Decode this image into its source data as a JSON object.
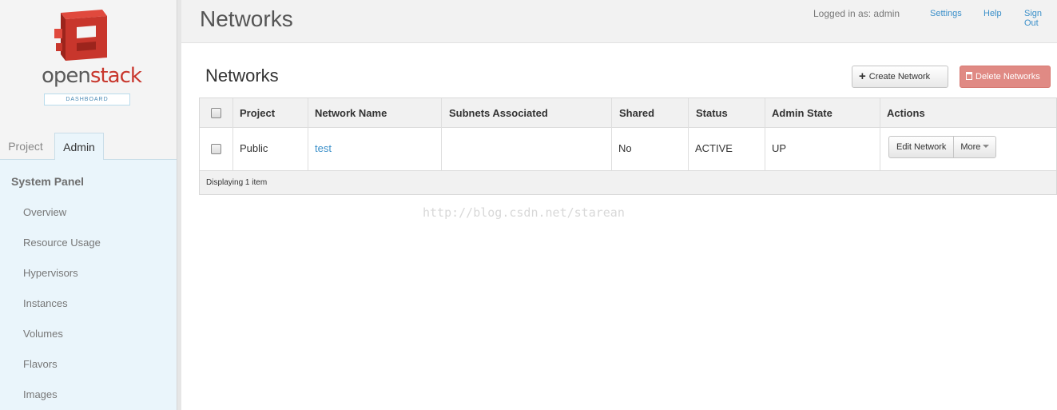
{
  "logo": {
    "brand_open": "open",
    "brand_stack": "stack",
    "subtitle": "DASHBOARD"
  },
  "sidebar": {
    "tabs": [
      {
        "label": "Project"
      },
      {
        "label": "Admin"
      }
    ],
    "panel_title": "System Panel",
    "items": [
      {
        "label": "Overview"
      },
      {
        "label": "Resource Usage"
      },
      {
        "label": "Hypervisors"
      },
      {
        "label": "Instances"
      },
      {
        "label": "Volumes"
      },
      {
        "label": "Flavors"
      },
      {
        "label": "Images"
      }
    ]
  },
  "header": {
    "title": "Networks",
    "logged_in": "Logged in as: admin",
    "links": {
      "settings": "Settings",
      "help": "Help",
      "sign_out": "Sign Out"
    }
  },
  "main": {
    "section_title": "Networks",
    "create_button": "Create Network",
    "delete_button": "Delete Networks",
    "table": {
      "columns": [
        "Project",
        "Network Name",
        "Subnets Associated",
        "Shared",
        "Status",
        "Admin State",
        "Actions"
      ],
      "rows": [
        {
          "project": "Public",
          "network_name": "test",
          "subnets": "",
          "shared": "No",
          "status": "ACTIVE",
          "admin_state": "UP",
          "action_edit": "Edit Network",
          "action_more": "More"
        }
      ],
      "footer": "Displaying 1 item"
    }
  },
  "watermark": "http://blog.csdn.net/starean",
  "colors": {
    "accent": "#3a8fc9",
    "brand_red": "#c8362c",
    "danger": "#e08a84"
  }
}
